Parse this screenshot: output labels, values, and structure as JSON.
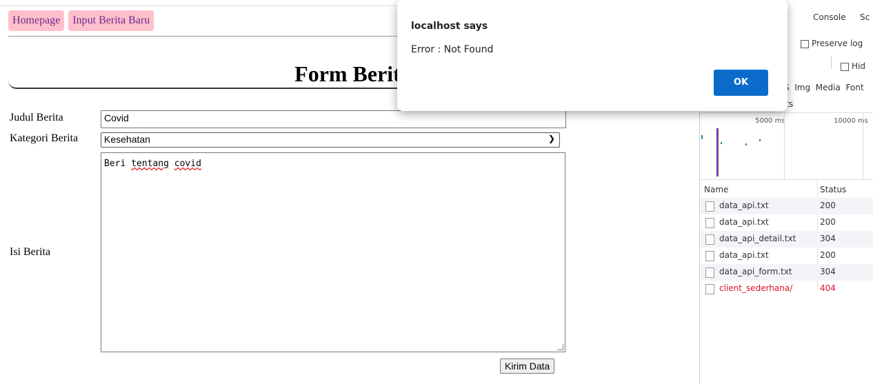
{
  "nav": {
    "home": "Homepage",
    "input_new": "Input Berita Baru"
  },
  "form": {
    "title": "Form Berita",
    "judul_label": "Judul Berita",
    "judul_value": "Covid",
    "kategori_label": "Kategori Berita",
    "kategori_value": "Kesehatan",
    "isi_label": "Isi Berita",
    "isi_value_words": [
      "Beri",
      "tentang",
      "covid"
    ],
    "submit_label": "Kirim Data"
  },
  "alert": {
    "title": "localhost says",
    "message": "Error : Not Found",
    "ok_label": "OK"
  },
  "devtools": {
    "tabs": [
      "ents",
      "Console",
      "Sc"
    ],
    "preserve_log": "Preserve log",
    "hide": "Hid",
    "filters": [
      "S",
      "Img",
      "Media",
      "Font"
    ],
    "sts": "sts",
    "timeline_ticks": [
      "5000 ms",
      "10000 ms"
    ],
    "columns": {
      "name": "Name",
      "status": "Status"
    },
    "requests": [
      {
        "name": "data_api.txt",
        "status": "200",
        "error": false
      },
      {
        "name": "data_api.txt",
        "status": "200",
        "error": false
      },
      {
        "name": "data_api_detail.txt",
        "status": "304",
        "error": false
      },
      {
        "name": "data_api.txt",
        "status": "200",
        "error": false
      },
      {
        "name": "data_api_form.txt",
        "status": "304",
        "error": false
      },
      {
        "name": "client_sederhana/",
        "status": "404",
        "error": true
      }
    ],
    "colors": {
      "error": "#d12222",
      "accent_blue": "#0b6bcb"
    }
  }
}
